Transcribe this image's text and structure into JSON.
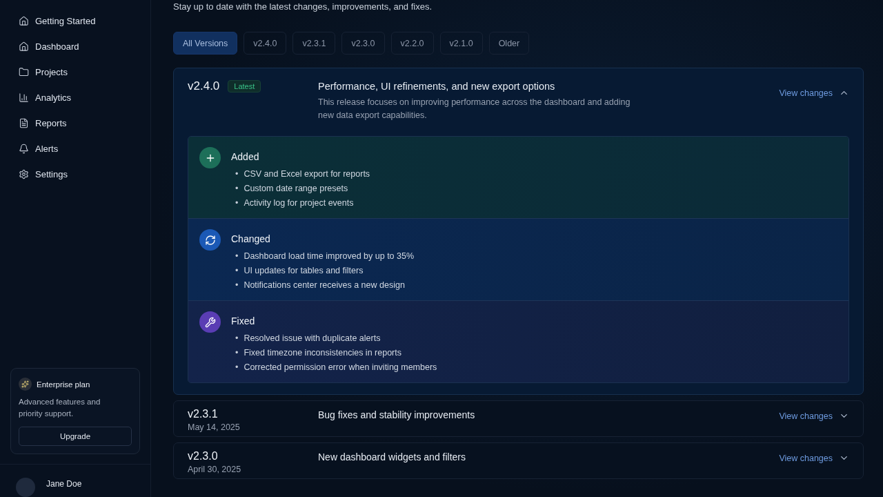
{
  "sidebar": {
    "items": [
      {
        "label": "Getting Started"
      },
      {
        "label": "Dashboard"
      },
      {
        "label": "Projects"
      },
      {
        "label": "Analytics"
      },
      {
        "label": "Reports"
      },
      {
        "label": "Alerts"
      },
      {
        "label": "Settings"
      }
    ],
    "plan": {
      "title": "Enterprise plan",
      "description": "Advanced features and priority support.",
      "button": "Upgrade"
    },
    "user": {
      "name": "Jane Doe"
    }
  },
  "subtitle": "Stay up to date with the latest changes, improvements, and fixes.",
  "filters": [
    {
      "label": "All Versions",
      "selected": true
    },
    {
      "label": "v2.4.0",
      "selected": false
    },
    {
      "label": "v2.3.1",
      "selected": false
    },
    {
      "label": "v2.3.0",
      "selected": false
    },
    {
      "label": "v2.2.0",
      "selected": false
    },
    {
      "label": "v2.1.0",
      "selected": false
    },
    {
      "label": "Older",
      "selected": false
    }
  ],
  "releases": [
    {
      "version": "v2.4.0",
      "badge": "Latest",
      "title": "Performance, UI refinements, and new export options",
      "description": "This release focuses on improving performance across the dashboard and adding new data export capabilities.",
      "toggle": "View changes",
      "expanded": true,
      "bullet": "•",
      "sections": [
        {
          "kind": "added",
          "title": "Added",
          "items": [
            "CSV and Excel export for reports",
            "Custom date range presets",
            "Activity log for project events"
          ]
        },
        {
          "kind": "changed",
          "title": "Changed",
          "items": [
            "Dashboard load time improved by up to 35%",
            "UI updates for tables and filters",
            "Notifications center receives a new design"
          ]
        },
        {
          "kind": "fixed",
          "title": "Fixed",
          "items": [
            "Resolved issue with duplicate alerts",
            "Fixed timezone inconsistencies in reports",
            "Corrected permission error when inviting members"
          ]
        }
      ]
    },
    {
      "version": "v2.3.1",
      "date": "May 14, 2025",
      "title": "Bug fixes and stability improvements",
      "toggle": "View changes",
      "expanded": false
    },
    {
      "version": "v2.3.0",
      "date": "April 30, 2025",
      "title": "New dashboard widgets and filters",
      "toggle": "View changes",
      "expanded": false
    }
  ]
}
